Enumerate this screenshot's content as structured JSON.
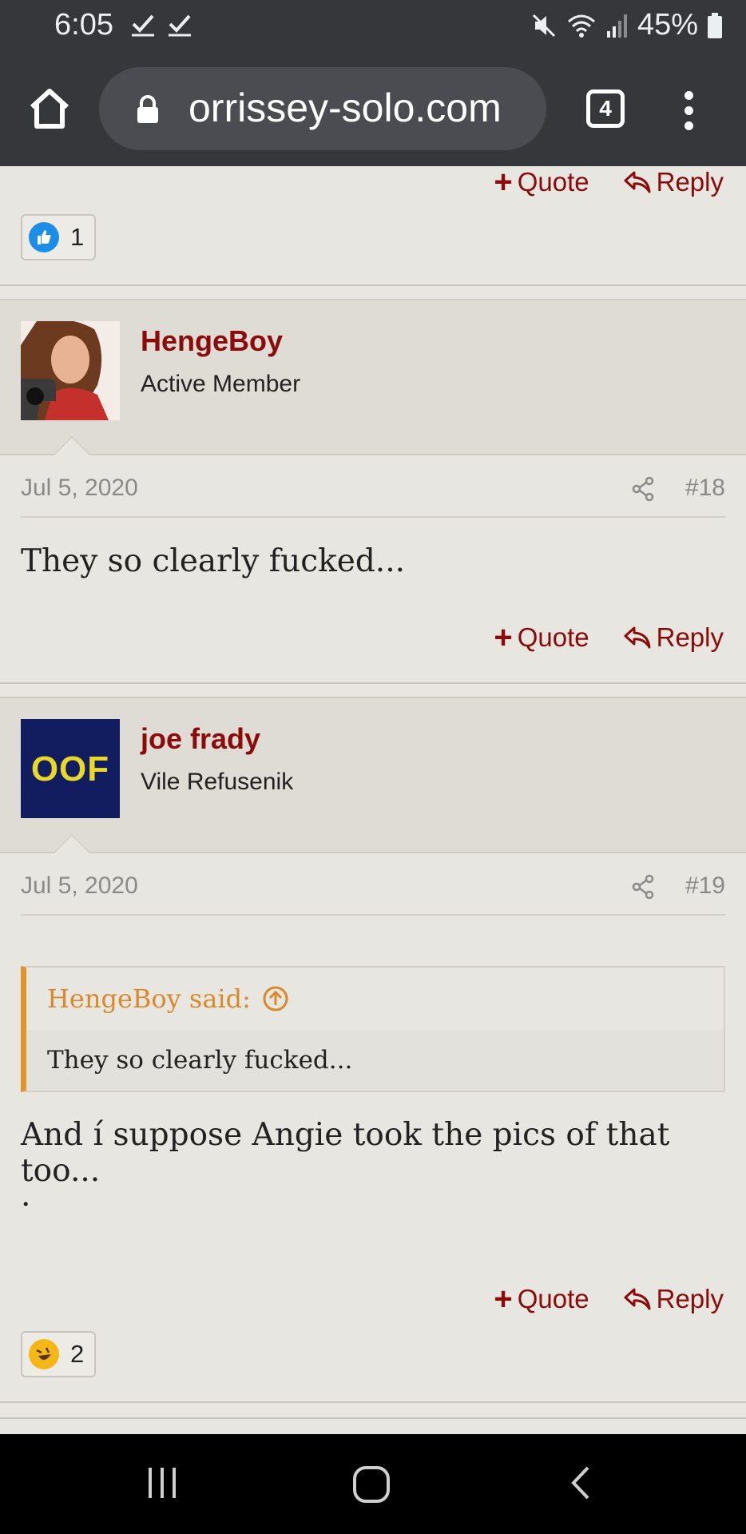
{
  "status_bar": {
    "time": "6:05",
    "battery_percent": "45%",
    "icons": [
      "check-icon",
      "check-icon",
      "mute-icon",
      "wifi-icon",
      "signal-icon",
      "battery-icon"
    ]
  },
  "browser": {
    "url": "orrissey-solo.com",
    "tab_count": "4"
  },
  "actions": {
    "quote_label": "Quote",
    "reply_label": "Reply"
  },
  "top_reaction": {
    "emoji": "like",
    "count": "1"
  },
  "posts": [
    {
      "username": "HengeBoy",
      "user_title": "Active Member",
      "date": "Jul 5, 2020",
      "post_number": "#18",
      "text": "They so clearly fucked..."
    },
    {
      "username": "joe frady",
      "user_title": "Vile Refusenik",
      "avatar_text": "OOF",
      "date": "Jul 5, 2020",
      "post_number": "#19",
      "quote": {
        "author": "HengeBoy said:",
        "text": "They so clearly fucked..."
      },
      "text": "And í suppose Angie took the pics of that too...",
      "text2": ".",
      "reaction": {
        "emoji": "laugh",
        "count": "2"
      }
    }
  ],
  "colors": {
    "accent": "#8b0a0a",
    "quote_bar": "#e0942c",
    "background": "#e8e6e0",
    "header_bg": "#dedcd5",
    "status_bar": "#35373b"
  }
}
